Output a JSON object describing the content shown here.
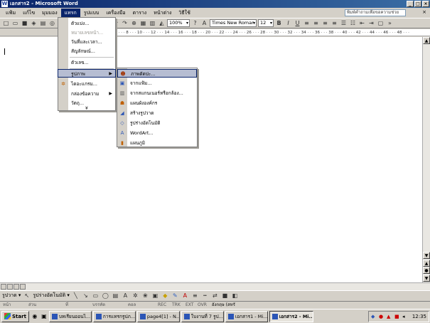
{
  "window": {
    "title": "เอกสาร2 - Microsoft Word",
    "buttons": [
      "_",
      "□",
      "×"
    ]
  },
  "menubar": {
    "items": [
      "แฟ้ม",
      "แก้ไข",
      "มุมมอง",
      "แทรก",
      "รูปแบบ",
      "เครื่องมือ",
      "ตาราง",
      "หน้าต่าง",
      "วิธีใช้"
    ],
    "active": "แทรก",
    "ask_box": "พิมพ์คำถามเพื่อขอความช่วย",
    "doc_close": "×"
  },
  "toolbar": {
    "zoom": "100%",
    "font": "Times New Roman",
    "size": "12"
  },
  "ruler": {
    "marks": "2 · · · 4 · · · 6 · · · 8 · · · 10 · · · 12 · · · 14 · · · 16 · · · 18 · · · 20 · · · 22 · · · 24 · · · 26 · · · 28 · · · 30 · · · 32 · · · 34 · · · 36 · · · 38 · · · 40 · · · 42 · · · 44 · · · 46 · · · 48 · · ·"
  },
  "insert_menu": {
    "items": [
      {
        "label": "ตัวแบ่ง...",
        "state": "normal"
      },
      {
        "label": "หมายเลขหน้า...",
        "state": "disabled"
      },
      {
        "label": "วันที่และเวลา...",
        "state": "normal"
      },
      {
        "label": "สัญลักษณ์...",
        "state": "normal"
      },
      {
        "label": "ตัวเลข...",
        "state": "normal"
      },
      {
        "label": "รูปภาพ",
        "state": "highlight",
        "submenu": true
      },
      {
        "label": "ไดอะแกรม...",
        "state": "normal"
      },
      {
        "label": "กล่องข้อความ",
        "state": "normal",
        "submenu": true
      },
      {
        "label": "วัตถุ...",
        "state": "normal"
      }
    ],
    "expand": "¥"
  },
  "picture_submenu": {
    "items": [
      {
        "label": "ภาพตัดปะ...",
        "icon": "clipart-icon",
        "state": "highlight"
      },
      {
        "label": "จากแฟ้ม...",
        "icon": "from-file-icon",
        "state": "normal"
      },
      {
        "label": "จากสแกนเนอร์หรือกล้อง...",
        "icon": "scanner-icon",
        "state": "normal"
      },
      {
        "label": "แผนผังองค์กร",
        "icon": "org-chart-icon",
        "state": "normal"
      },
      {
        "label": "สร้างรูปวาด",
        "icon": "new-drawing-icon",
        "state": "normal"
      },
      {
        "label": "รูปร่างอัตโนมัติ",
        "icon": "autoshape-icon",
        "state": "normal"
      },
      {
        "label": "WordArt...",
        "icon": "wordart-icon",
        "state": "normal"
      },
      {
        "label": "แผนภูมิ",
        "icon": "chart-icon",
        "state": "normal"
      }
    ]
  },
  "drawing_toolbar": {
    "draw": "รูปวาด ▾",
    "autoshapes": "รูปร่างอัตโนมัติ ▾"
  },
  "statusbar": {
    "page": "หน้า",
    "section": "ส่วน",
    "at": "ที่",
    "line": "บรรทัด",
    "col": "คอล",
    "rec": "REC",
    "trk": "TRK",
    "ext": "EXT",
    "ovr": "OVR",
    "language": "อังกฤษ (สหรั"
  },
  "taskbar": {
    "start": "Start",
    "tasks": [
      {
        "label": "บทเรียนออนไ...",
        "pressed": false
      },
      {
        "label": "การแทรกรูปภ...",
        "pressed": false
      },
      {
        "label": "page4[1] - N...",
        "pressed": false
      },
      {
        "label": "ใบงานที่ 7 รูป...",
        "pressed": false
      },
      {
        "label": "เอกสาร1 - Mi...",
        "pressed": false
      },
      {
        "label": "เอกสาร2 - Mi...",
        "pressed": true
      }
    ],
    "clock": "12:35"
  },
  "colors": {
    "title_start": "#0a246a",
    "title_end": "#3a6ea5",
    "menu_highlight": "#b6bdd2"
  }
}
